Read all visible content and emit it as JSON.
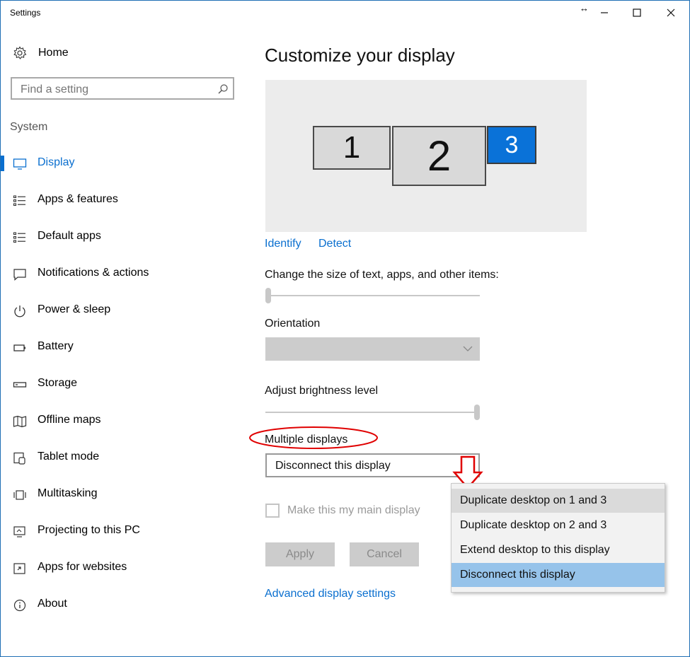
{
  "window": {
    "title": "Settings"
  },
  "sidebar": {
    "home_label": "Home",
    "search_placeholder": "Find a setting",
    "section_label": "System",
    "items": [
      {
        "label": "Display",
        "icon": "monitor-icon",
        "active": true
      },
      {
        "label": "Apps & features",
        "icon": "list-icon"
      },
      {
        "label": "Default apps",
        "icon": "list-icon"
      },
      {
        "label": "Notifications & actions",
        "icon": "notification-icon"
      },
      {
        "label": "Power & sleep",
        "icon": "power-icon"
      },
      {
        "label": "Battery",
        "icon": "battery-icon"
      },
      {
        "label": "Storage",
        "icon": "storage-icon"
      },
      {
        "label": "Offline maps",
        "icon": "map-icon"
      },
      {
        "label": "Tablet mode",
        "icon": "tablet-icon"
      },
      {
        "label": "Multitasking",
        "icon": "multitasking-icon"
      },
      {
        "label": "Projecting to this PC",
        "icon": "projecting-icon"
      },
      {
        "label": "Apps for websites",
        "icon": "apps-websites-icon"
      },
      {
        "label": "About",
        "icon": "info-icon"
      }
    ]
  },
  "main": {
    "title": "Customize your display",
    "monitors": [
      {
        "number": "1"
      },
      {
        "number": "2"
      },
      {
        "number": "3",
        "selected": true
      }
    ],
    "identify_label": "Identify",
    "detect_label": "Detect",
    "scale_label": "Change the size of text, apps, and other items:",
    "scale_level": 0,
    "orientation_label": "Orientation",
    "orientation_value": "",
    "brightness_label": "Adjust brightness level",
    "brightness_level": 1.0,
    "multiple_displays_label": "Multiple displays",
    "multiple_displays_value": "Disconnect this display",
    "main_display_label": "Make this my main display",
    "apply_label": "Apply",
    "cancel_label": "Cancel",
    "advanced_label": "Advanced display settings"
  },
  "dropdown_menu": {
    "options": [
      {
        "label": "Duplicate desktop on 1 and 3",
        "state": "hover"
      },
      {
        "label": "Duplicate desktop on 2 and 3",
        "state": ""
      },
      {
        "label": "Extend desktop to this display",
        "state": ""
      },
      {
        "label": "Disconnect this display",
        "state": "selected"
      }
    ]
  },
  "colors": {
    "accent": "#0a6fcf",
    "annotation_red": "#e00000",
    "selected_option": "#96c3ea",
    "selected_monitor": "#0a72d8"
  }
}
